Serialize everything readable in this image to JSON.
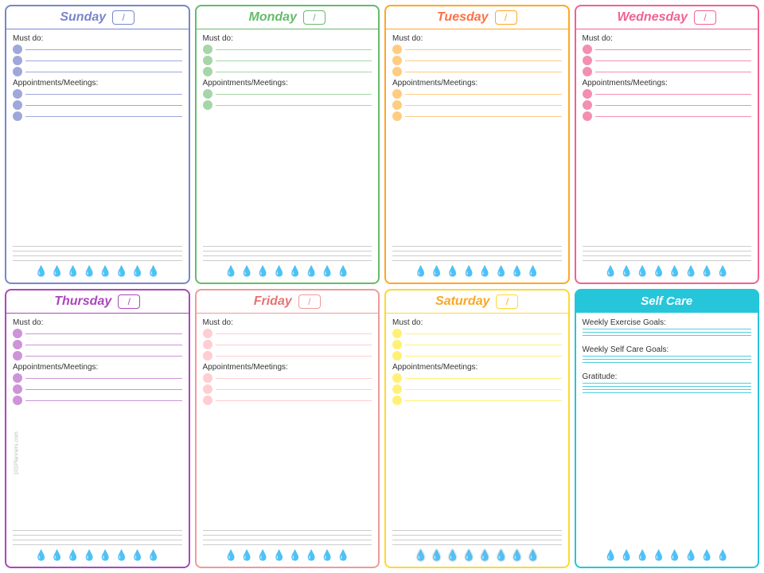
{
  "days": [
    {
      "id": "sunday",
      "cssClass": "sunday",
      "dropClass": "watercolor-sunday",
      "title": "Sunday",
      "mustDoLabel": "Must do:",
      "appointmentsLabel": "Appointments/Meetings:",
      "bullets": 3,
      "apptBullets": 3,
      "noteLines": 4,
      "waterDrops": 8
    },
    {
      "id": "monday",
      "cssClass": "monday",
      "dropClass": "watercolor-monday",
      "title": "Monday",
      "mustDoLabel": "Must do:",
      "appointmentsLabel": "Appointments/Meetings:",
      "bullets": 3,
      "apptBullets": 2,
      "noteLines": 4,
      "waterDrops": 8
    },
    {
      "id": "tuesday",
      "cssClass": "tuesday",
      "dropClass": "watercolor-tuesday",
      "title": "Tuesday",
      "mustDoLabel": "Must do:",
      "appointmentsLabel": "Appointments/Meetings:",
      "bullets": 3,
      "apptBullets": 3,
      "noteLines": 4,
      "waterDrops": 8
    },
    {
      "id": "wednesday",
      "cssClass": "wednesday",
      "dropClass": "watercolor-wednesday",
      "title": "Wednesday",
      "mustDoLabel": "Must do:",
      "appointmentsLabel": "Appointments/Meetings:",
      "bullets": 3,
      "apptBullets": 3,
      "noteLines": 4,
      "waterDrops": 8
    },
    {
      "id": "thursday",
      "cssClass": "thursday",
      "dropClass": "watercolor-thursday",
      "title": "Thursday",
      "mustDoLabel": "Must do:",
      "appointmentsLabel": "Appointments/Meetings:",
      "bullets": 3,
      "apptBullets": 3,
      "noteLines": 4,
      "waterDrops": 8
    },
    {
      "id": "friday",
      "cssClass": "friday",
      "dropClass": "watercolor-friday",
      "title": "Friday",
      "mustDoLabel": "Must do:",
      "appointmentsLabel": "Appointments/Meetings:",
      "bullets": 3,
      "apptBullets": 3,
      "noteLines": 4,
      "waterDrops": 8
    },
    {
      "id": "saturday",
      "cssClass": "saturday",
      "dropClass": "watercolor-saturday",
      "title": "Saturday",
      "mustDoLabel": "Must do:",
      "appointmentsLabel": "Appointments/Meetings:",
      "bullets": 3,
      "apptBullets": 3,
      "noteLines": 4,
      "waterDrops": 8
    }
  ],
  "selfCare": {
    "title": "Self Care",
    "exerciseLabel": "Weekly Exercise Goals:",
    "selfCareGoalsLabel": "Weekly Self Care Goals:",
    "gratitudeLabel": "Gratitude:",
    "dropClass": "watercolor-selfcare",
    "waterDrops": 8
  },
  "watermark": "101Planners.com",
  "slashLabel": "/"
}
